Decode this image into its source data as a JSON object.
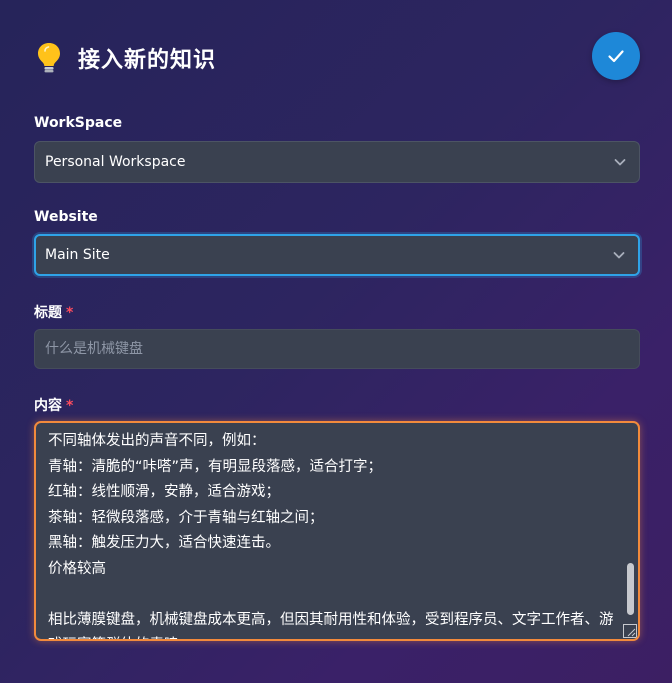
{
  "dialog": {
    "title": "接入新的知识",
    "confirm_label": "✓"
  },
  "workspace": {
    "label": "WorkSpace",
    "selected": "Personal Workspace"
  },
  "website": {
    "label": "Website",
    "selected": "Main Site"
  },
  "title_field": {
    "label": "标题",
    "required_mark": "*",
    "placeholder": "什么是机械键盘"
  },
  "content_field": {
    "label": "内容",
    "required_mark": "*",
    "lines": [
      "不同轴体发出的声音不同，例如：",
      "青轴：清脆的“咔嗒”声，有明显段落感，适合打字；",
      "红轴：线性顺滑，安静，适合游戏；",
      "茶轴：轻微段落感，介于青轴与红轴之间；",
      "黑轴：触发压力大，适合快速连击。",
      "价格较高",
      "",
      "相比薄膜键盘，机械键盘成本更高，但因其耐用性和体验，受到程序员、文字工作者、游戏玩家等群体的青睐。"
    ]
  },
  "colors": {
    "accent_blue": "#1e88d8",
    "focus_orange": "#f28a3c",
    "required_red": "#ff4d5e",
    "field_bg": "#3a4150"
  },
  "icons": {
    "header": "lightbulb-icon",
    "confirm": "check-icon",
    "dropdown": "chevron-down-icon"
  }
}
